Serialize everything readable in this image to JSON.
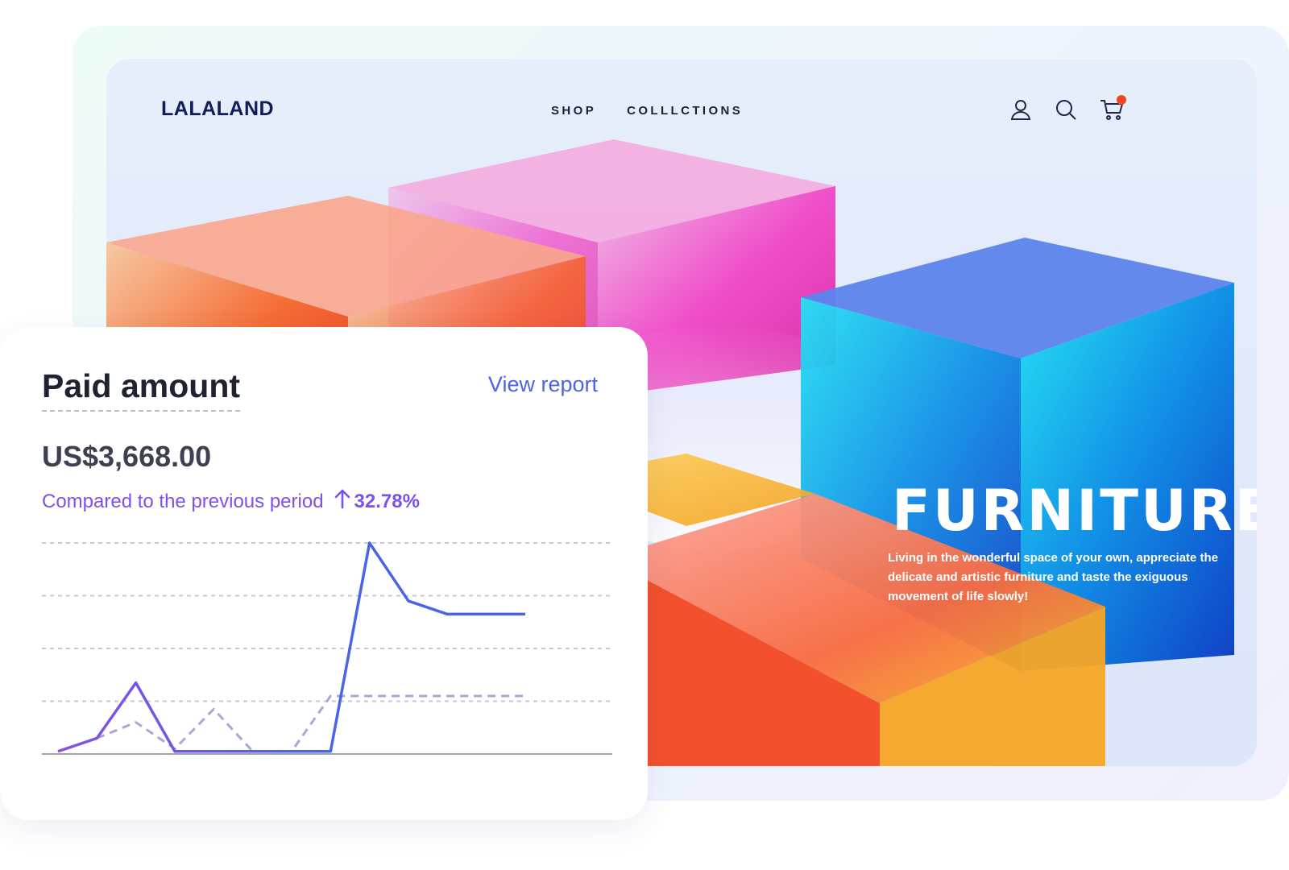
{
  "site": {
    "logo": "LALALAND",
    "nav": [
      "SHOP",
      "COLLLCTIONS"
    ],
    "icons": [
      "user-icon",
      "search-icon",
      "cart-icon"
    ],
    "hero_title": "FURNITURE",
    "hero_text": "Living in the wonderful space of your own, appreciate the delicate and artistic furniture and taste the exiguous movement of life slowly!"
  },
  "card": {
    "title": "Paid amount",
    "view_report": "View report",
    "amount": "US$3,668.00",
    "compare_label": "Compared to the previous period",
    "compare_value": "32.78%"
  },
  "colors": {
    "current_series": "#4a63e8",
    "current_series_start": "#8a4fe6",
    "previous_series": "#aaa6d6",
    "accent_text": "#7b52e9",
    "link": "#4a63e8",
    "logo": "#0f1e5a",
    "cart_badge": "#f2441d"
  },
  "chart_data": {
    "type": "line",
    "grid": true,
    "x": [
      0,
      1,
      2,
      3,
      4,
      5,
      6,
      7,
      8,
      9,
      10,
      11,
      12
    ],
    "ylim": [
      0,
      4
    ],
    "series": [
      {
        "values": [
          0.05,
          0.3,
          1.35,
          0.05,
          0.05,
          0.05,
          0.05,
          0.05,
          4.0,
          2.9,
          2.65,
          2.65,
          2.65
        ]
      },
      {
        "values": [
          0.05,
          0.3,
          0.6,
          0.1,
          0.85,
          0.05,
          0.05,
          1.1,
          1.1,
          1.1,
          1.1,
          1.1,
          1.1
        ]
      }
    ]
  }
}
